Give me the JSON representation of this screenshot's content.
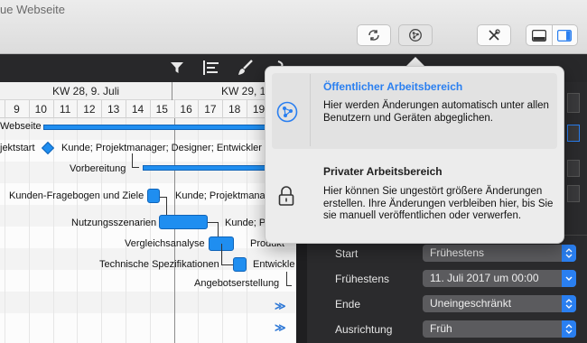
{
  "window": {
    "title": "ue Webseite"
  },
  "gantt": {
    "weeks": [
      "KW 28, 9. Juli",
      "KW 29, 1"
    ],
    "days": [
      "9",
      "10",
      "11",
      "12",
      "13",
      "14",
      "15",
      "16",
      "17",
      "18",
      "19"
    ],
    "rows": {
      "project": "Webseite",
      "projectstart": "jektstart",
      "projectstart_res": "Kunde; Projektmanager; Designer; Entwickler",
      "vorbereitung": "Vorbereitung",
      "fragebogen": "Kunden-Fragebogen und Ziele",
      "fragebogen_res": "Kunde; Projektmanag",
      "nutzung": "Nutzungsszenarien",
      "nutzung_res": "Kunde; P",
      "vergleich": "Vergleichsanalyse",
      "vergleich_res": "Produkt",
      "spezifikationen": "Technische Spezifikationen",
      "spezifikationen_res": "Entwickle",
      "angebot": "Angebotserstellung"
    },
    "more_glyph": "≫"
  },
  "popover": {
    "public": {
      "title": "Öffentlicher Arbeitsbereich",
      "desc": "Hier werden Änderungen automatisch unter allen Benutzern und Geräten abgeglichen."
    },
    "private": {
      "title": "Privater Arbeitsbereich",
      "desc": "Hier können Sie ungestört größere Änderungen erstellen. Ihre Änderungen verbleiben hier, bis Sie sie manuell veröffentlichen oder verwerfen."
    }
  },
  "inspector": {
    "start_label": "Start",
    "start_value": "Frühestens",
    "earliest_label": "Frühestens",
    "earliest_value": "11. Juli 2017 um 00:00",
    "end_label": "Ende",
    "end_value": "Uneingeschränkt",
    "align_label": "Ausrichtung",
    "align_value": "Früh"
  },
  "colors": {
    "accent": "#1f8ef0",
    "popover_title": "#2a7ff0"
  }
}
